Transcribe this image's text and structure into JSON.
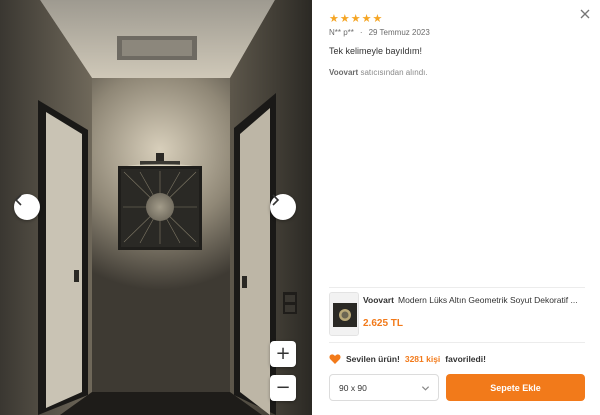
{
  "gallery": {
    "prev_icon": "chevron-left-icon",
    "next_icon": "chevron-right-icon",
    "zoom_in_label": "+",
    "zoom_out_label": "−"
  },
  "review": {
    "rating": 5,
    "star_char": "★",
    "author": "N** p**",
    "separator": "·",
    "date": "29 Temmuz 2023",
    "comment": "Tek kelimeyle bayıldım!",
    "seller_name": "Voovart",
    "seller_suffix": "satıcısından alındı."
  },
  "product": {
    "brand": "Voovart",
    "title": "Modern Lüks Altın Geometrik Soyut Dekoratif ...",
    "price": "2.625 TL"
  },
  "favorites": {
    "prefix": "Sevilen ürün!",
    "count": "3281 kişi",
    "suffix": "favoriledi!"
  },
  "size_select": {
    "selected": "90 x 90"
  },
  "actions": {
    "add_to_cart": "Sepete Ekle"
  },
  "colors": {
    "accent": "#f27a1a",
    "star": "#f5a524"
  }
}
